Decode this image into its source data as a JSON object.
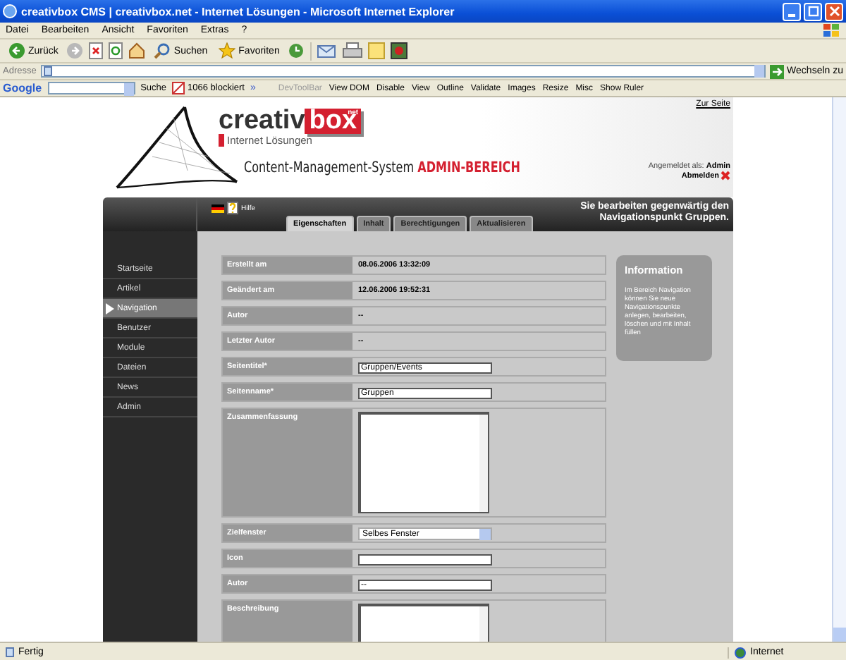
{
  "window": {
    "title": "creativbox CMS | creativbox.net - Internet Lösungen - Microsoft Internet Explorer"
  },
  "menu": [
    "Datei",
    "Bearbeiten",
    "Ansicht",
    "Favoriten",
    "Extras",
    "?"
  ],
  "toolbar": {
    "back": "Zurück",
    "search": "Suchen",
    "favorites": "Favoriten"
  },
  "address_bar": {
    "label": "Adresse",
    "go": "Wechseln zu"
  },
  "google_bar": {
    "logo": "Google",
    "search": "Suche",
    "blocked": "1066 blockiert",
    "more": "»",
    "dev_items": [
      {
        "label": "DevToolBar",
        "disabled": true
      },
      {
        "label": "View DOM",
        "disabled": false
      },
      {
        "label": "Disable",
        "disabled": false
      },
      {
        "label": "View",
        "disabled": false
      },
      {
        "label": "Outline",
        "disabled": false
      },
      {
        "label": "Validate",
        "disabled": false
      },
      {
        "label": "Images",
        "disabled": false
      },
      {
        "label": "Resize",
        "disabled": false
      },
      {
        "label": "Misc",
        "disabled": false
      },
      {
        "label": "Show Ruler",
        "disabled": false
      }
    ]
  },
  "header": {
    "site_link": "Zur Seite",
    "logo_main": "creativ",
    "logo_box": "box",
    "logo_tld": "net",
    "tagline": "Internet Lösungen",
    "cms_title": "Content-Management-System",
    "cms_area": "ADMIN-BEREICH",
    "logged_in_label": "Angemeldet als:",
    "user": "Admin",
    "logout": "Abmelden"
  },
  "top_bar": {
    "help": "Hilfe",
    "notice": "Sie bearbeiten gegenwärtig den Navigationspunkt Gruppen."
  },
  "tabs": [
    {
      "label": "Eigenschaften",
      "selected": true
    },
    {
      "label": "Inhalt",
      "selected": false
    },
    {
      "label": "Berechtigungen",
      "selected": false
    },
    {
      "label": "Aktualisieren",
      "selected": false
    }
  ],
  "sidebar": {
    "items": [
      {
        "label": "Startseite",
        "selected": false
      },
      {
        "label": "Artikel",
        "selected": false
      },
      {
        "label": "Navigation",
        "selected": true
      },
      {
        "label": "Benutzer",
        "selected": false
      },
      {
        "label": "Module",
        "selected": false
      },
      {
        "label": "Dateien",
        "selected": false
      },
      {
        "label": "News",
        "selected": false
      },
      {
        "label": "Admin",
        "selected": false
      }
    ]
  },
  "form": [
    {
      "label": "Erstellt am",
      "kind": "static",
      "value": "08.06.2006 13:32:09"
    },
    {
      "label": "Geändert am",
      "kind": "static",
      "value": "12.06.2006 19:52:31"
    },
    {
      "label": "Autor",
      "kind": "static",
      "value": "--"
    },
    {
      "label": "Letzter Autor",
      "kind": "static",
      "value": "--"
    },
    {
      "label": "Seitentitel*",
      "kind": "input",
      "value": "Gruppen/Events"
    },
    {
      "label": "Seitenname*",
      "kind": "input",
      "value": "Gruppen"
    },
    {
      "label": "Zusammenfassung",
      "kind": "textarea"
    },
    {
      "label": "Zielfenster",
      "kind": "select",
      "value": "Selbes Fenster"
    },
    {
      "label": "Icon",
      "kind": "input"
    },
    {
      "label": "Autor",
      "kind": "input",
      "value": "--"
    },
    {
      "label": "Beschreibung",
      "kind": "textarea"
    }
  ],
  "info": {
    "title": "Information",
    "text": "Im Bereich Navigation können Sie neue Navigationspunkte anlegen, bearbeiten, löschen und mit Inhalt füllen"
  },
  "status_bar": {
    "text": "Fertig",
    "zone": "Internet"
  }
}
